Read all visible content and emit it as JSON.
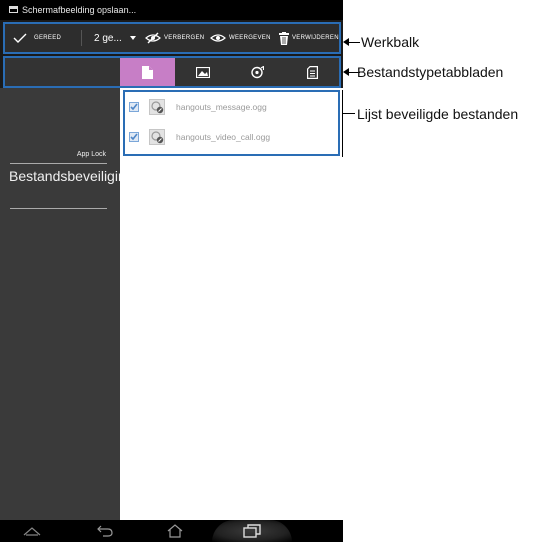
{
  "status_bar": {
    "notification_text": "Schermafbeelding opslaan..."
  },
  "toolbar": {
    "done_label": "GEREED",
    "selection_count": "2 ge...",
    "hide_label": "VERBERGEN",
    "show_label": "WEERGEVEN",
    "delete_label": "VERWIJDEREN"
  },
  "sidebar": {
    "app_label": "App Lock",
    "section_title": "Bestandsbeveiliging"
  },
  "files": [
    {
      "name": "hangouts_message.ogg",
      "checked": true
    },
    {
      "name": "hangouts_video_call.ogg",
      "checked": true
    }
  ],
  "callouts": {
    "toolbar": "Werkbalk",
    "tabs": "Bestandstypetabbladen",
    "list": "Lijst beveiligde bestanden"
  },
  "colors": {
    "accent_outline": "#2a6db5",
    "active_tab": "#c77ec6",
    "checkbox": "#4f86c6"
  },
  "icons": {
    "tabs": [
      "document-icon",
      "image-icon",
      "audio-icon",
      "other-file-icon"
    ],
    "nav": [
      "back-icon",
      "home-icon",
      "recent-apps-icon"
    ]
  }
}
